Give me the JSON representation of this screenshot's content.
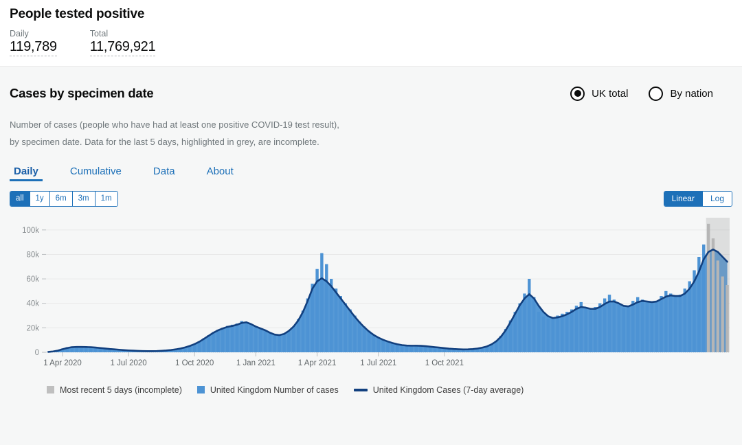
{
  "summary": {
    "title": "People tested positive",
    "metrics": [
      {
        "label": "Daily",
        "value": "119,789"
      },
      {
        "label": "Total",
        "value": "11,769,921"
      }
    ]
  },
  "card": {
    "title": "Cases by specimen date",
    "description_line1": "Number of cases (people who have had at least one positive COVID-19 test result),",
    "description_line2": "by specimen date. Data for the last 5 days, highlighted in grey, are incomplete.",
    "nation_toggle": {
      "options": [
        {
          "label": "UK total",
          "selected": true
        },
        {
          "label": "By nation",
          "selected": false
        }
      ]
    },
    "tabs": [
      {
        "label": "Daily",
        "active": true
      },
      {
        "label": "Cumulative",
        "active": false
      },
      {
        "label": "Data",
        "active": false
      },
      {
        "label": "About",
        "active": false
      }
    ],
    "range_buttons": [
      {
        "label": "all",
        "active": true
      },
      {
        "label": "1y",
        "active": false
      },
      {
        "label": "6m",
        "active": false
      },
      {
        "label": "3m",
        "active": false
      },
      {
        "label": "1m",
        "active": false
      }
    ],
    "scale_buttons": [
      {
        "label": "Linear",
        "active": true
      },
      {
        "label": "Log",
        "active": false
      }
    ]
  },
  "colors": {
    "bar_blue": "#4d93d4",
    "line_navy": "#12407f",
    "incomplete_grey": "#bfbfbf",
    "link_blue": "#1d70b8",
    "plot_background": "#f6f7f7",
    "gridline": "#e8e8e8",
    "axis_text": "#8a8f92"
  },
  "chart_data": {
    "type": "bar",
    "title": "Cases by specimen date",
    "subtitle": "Number of cases (people who have had at least one positive COVID-19 test result), by specimen date. Data for the last 5 days, highlighted in grey, are incomplete.",
    "xlabel": "",
    "ylabel": "",
    "ylim": [
      0,
      110000
    ],
    "grid": true,
    "legend_position": "bottom",
    "y_ticks": [
      {
        "value": 0,
        "label": "0"
      },
      {
        "value": 20000,
        "label": "20k"
      },
      {
        "value": 40000,
        "label": "40k"
      },
      {
        "value": 60000,
        "label": "60k"
      },
      {
        "value": 80000,
        "label": "80k"
      },
      {
        "value": 100000,
        "label": "100k"
      }
    ],
    "x_ticks": [
      {
        "index": 3,
        "label": "1 Apr 2020"
      },
      {
        "index": 17,
        "label": "1 Jul 2020"
      },
      {
        "index": 31,
        "label": "1 Oct 2020"
      },
      {
        "index": 44,
        "label": "1 Jan 2021"
      },
      {
        "index": 57,
        "label": "1 Apr 2021"
      },
      {
        "index": 70,
        "label": "1 Jul 2021"
      },
      {
        "index": 84,
        "label": "1 Oct 2021"
      }
    ],
    "x_range": [
      "2020-03-01",
      "2021-12-22"
    ],
    "legend": [
      {
        "name": "Most recent 5 days (incomplete)",
        "marker": "square",
        "color": "#bfbfbf"
      },
      {
        "name": "United Kingdom Number of cases",
        "marker": "square",
        "color": "#4d93d4"
      },
      {
        "name": "United Kingdom Cases (7-day average)",
        "marker": "line",
        "color": "#12407f"
      }
    ],
    "incomplete_tail_count": 5,
    "series": [
      {
        "name": "United Kingdom Number of cases",
        "type": "bar",
        "color": "#4d93d4",
        "values": [
          400,
          900,
          1800,
          3100,
          4200,
          4800,
          4500,
          4200,
          4600,
          4300,
          3900,
          3400,
          3000,
          2600,
          2300,
          2000,
          1700,
          1500,
          1300,
          1100,
          950,
          900,
          950,
          1100,
          1300,
          1600,
          2000,
          2600,
          3300,
          4200,
          5400,
          7000,
          9000,
          11500,
          14000,
          16500,
          18500,
          20000,
          21500,
          22500,
          23500,
          25500,
          24000,
          22000,
          20500,
          19500,
          18000,
          16000,
          14500,
          13500,
          14500,
          17000,
          21000,
          27000,
          34000,
          44000,
          56000,
          68000,
          81000,
          72000,
          60000,
          52000,
          46000,
          40000,
          35000,
          30000,
          25000,
          21000,
          17500,
          14500,
          12000,
          10000,
          8500,
          7200,
          6300,
          5600,
          5200,
          5500,
          6000,
          5700,
          5200,
          4700,
          4200,
          3700,
          3300,
          2900,
          2600,
          2400,
          2300,
          2400,
          2700,
          3200,
          3900,
          5000,
          6800,
          9500,
          13500,
          19000,
          26000,
          33000,
          40000,
          48000,
          60000,
          45000,
          33000,
          29000,
          27500,
          28500,
          30000,
          31500,
          33000,
          35000,
          38000,
          41000,
          36000,
          34000,
          37000,
          40000,
          44000,
          47000,
          43000,
          39000,
          36000,
          38000,
          42000,
          45000,
          43000,
          41000,
          40000,
          42000,
          46000,
          50000,
          48000,
          46000,
          47000,
          52000,
          58000,
          67000,
          78000,
          88000,
          105000,
          93000,
          75000,
          62000,
          55000
        ]
      },
      {
        "name": "United Kingdom Cases (7-day average)",
        "type": "line",
        "color": "#12407f",
        "values": [
          300,
          700,
          1400,
          2500,
          3500,
          4200,
          4400,
          4400,
          4300,
          4200,
          3900,
          3500,
          3100,
          2700,
          2400,
          2100,
          1800,
          1550,
          1350,
          1150,
          1000,
          920,
          950,
          1050,
          1250,
          1500,
          1900,
          2400,
          3100,
          4000,
          5200,
          6700,
          8600,
          11000,
          13500,
          16000,
          18000,
          19500,
          20800,
          21500,
          22500,
          24000,
          24500,
          23000,
          21000,
          19500,
          18000,
          16000,
          14500,
          14000,
          15000,
          17500,
          21000,
          26000,
          33000,
          42000,
          52000,
          58000,
          60500,
          58000,
          54000,
          49000,
          44000,
          39000,
          34000,
          29000,
          24500,
          20500,
          17000,
          14200,
          12000,
          10200,
          8800,
          7600,
          6600,
          5900,
          5500,
          5400,
          5400,
          5300,
          5000,
          4600,
          4200,
          3800,
          3400,
          3000,
          2700,
          2500,
          2350,
          2400,
          2650,
          3100,
          3800,
          4800,
          6500,
          9000,
          12800,
          18000,
          24500,
          31500,
          38500,
          44000,
          47500,
          44000,
          38000,
          33000,
          29500,
          28000,
          28500,
          29500,
          31000,
          33000,
          35500,
          37000,
          36500,
          35500,
          35500,
          37000,
          39500,
          41500,
          41500,
          40000,
          38000,
          37500,
          39000,
          41000,
          42000,
          41500,
          41000,
          41500,
          43500,
          45500,
          46500,
          46000,
          46000,
          48000,
          52000,
          58000,
          66000,
          76000,
          82000,
          84000,
          82000,
          78000,
          74000
        ]
      }
    ]
  }
}
